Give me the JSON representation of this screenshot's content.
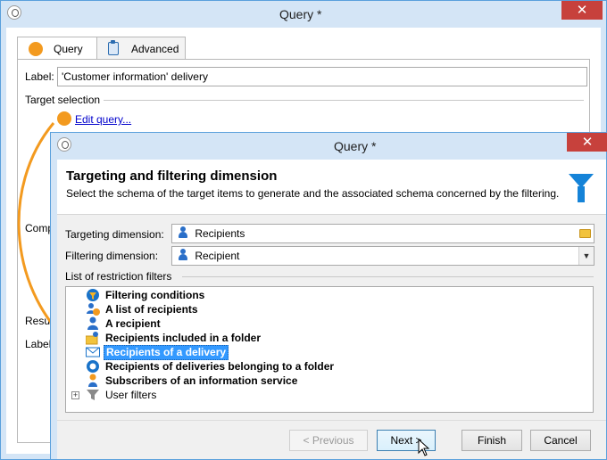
{
  "back_window": {
    "title": "Query *",
    "close_glyph": "✕",
    "tabs": [
      {
        "label": "Query",
        "icon": "orange-circle-icon"
      },
      {
        "label": "Advanced",
        "icon": "clipboard-icon"
      }
    ],
    "label_field": {
      "label": "Label:",
      "value": "'Customer information' delivery"
    },
    "target_selection": "Target selection",
    "edit_query": "Edit query...",
    "comp_text": "Comp",
    "resu_text": "Resu",
    "label2_text": "Label:"
  },
  "dialog": {
    "title": "Query *",
    "close_glyph": "✕",
    "heading": "Targeting and filtering dimension",
    "subheading": "Select the schema of the target items to  generate and the associated schema concerned by the filtering.",
    "targeting": {
      "label": "Targeting dimension:",
      "value": "Recipients"
    },
    "filtering": {
      "label": "Filtering dimension:",
      "value": "Recipient"
    },
    "restriction_label": "List of restriction filters",
    "filters": [
      {
        "label": "Filtering conditions",
        "icon": "filter-conditions-icon"
      },
      {
        "label": "A list of recipients",
        "icon": "recipient-list-icon"
      },
      {
        "label": "A recipient",
        "icon": "recipient-icon"
      },
      {
        "label": "Recipients included in a folder",
        "icon": "folder-recipient-icon"
      },
      {
        "label": "Recipients of a delivery",
        "icon": "delivery-envelope-icon",
        "selected": true
      },
      {
        "label": "Recipients of deliveries belonging to a folder",
        "icon": "delivery-folder-icon"
      },
      {
        "label": "Subscribers of an information service",
        "icon": "subscriber-icon"
      },
      {
        "label": "User filters",
        "icon": "funnel-icon",
        "expandable": true
      }
    ],
    "buttons": {
      "previous": "< Previous",
      "next": "Next >",
      "finish": "Finish",
      "cancel": "Cancel"
    }
  },
  "colors": {
    "title_bar": "#d4e5f6",
    "close": "#c7413c",
    "accent_orange": "#f39a1f",
    "selection": "#3399ff"
  }
}
